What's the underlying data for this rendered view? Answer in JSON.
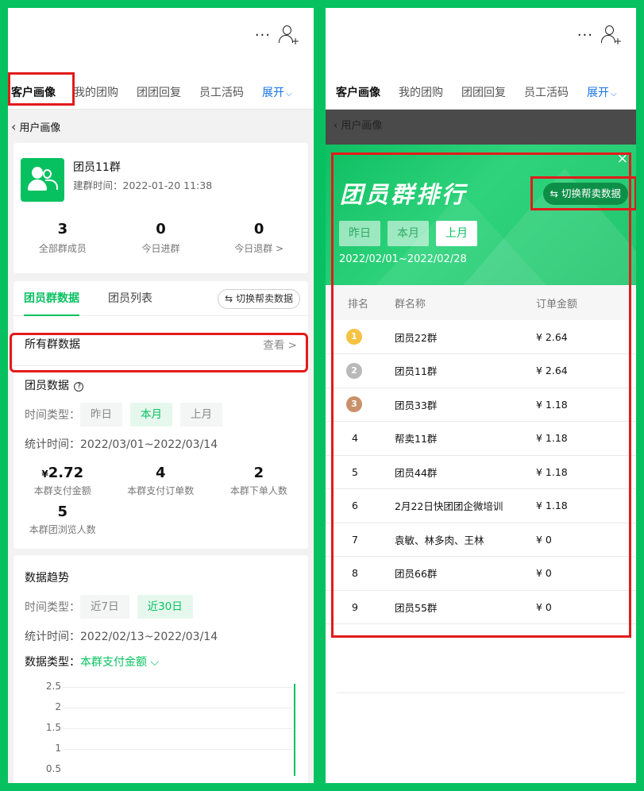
{
  "app": {
    "tabs": [
      "客户画像",
      "我的团购",
      "团团回复",
      "员工活码",
      "展开"
    ],
    "more_icon": "more-dots-icon",
    "user_icon": "add-user-icon",
    "back_label": "用户画像"
  },
  "left": {
    "group": {
      "name": "团员11群",
      "created": "建群时间：2022-01-20 11:38",
      "stats": [
        {
          "value": "3",
          "label": "全部群成员"
        },
        {
          "value": "0",
          "label": "今日进群"
        },
        {
          "value": "0",
          "label": "今日退群 >"
        }
      ]
    },
    "subtabs": [
      "团员群数据",
      "团员列表"
    ],
    "switch_label": "⇆ 切换帮卖数据",
    "all_groups": {
      "label": "所有群数据",
      "view": "查看 >"
    },
    "member_data": {
      "title": "团员数据",
      "time_type_label": "时间类型：",
      "chips": [
        "昨日",
        "本月",
        "上月"
      ],
      "stat_time": "统计时间：2022/03/01~2022/03/14",
      "kpis": [
        {
          "currency": "¥",
          "value": "2.72",
          "label": "本群支付金额"
        },
        {
          "value": "4",
          "label": "本群支付订单数"
        },
        {
          "value": "2",
          "label": "本群下单人数"
        },
        {
          "value": "5",
          "label": "本群团浏览人数"
        }
      ]
    },
    "trend": {
      "title": "数据趋势",
      "time_type_label": "时间类型：",
      "chips": [
        "近7日",
        "近30日"
      ],
      "stat_time": "统计时间：2022/02/13~2022/03/14",
      "data_type_label": "数据类型：",
      "data_type_value": "本群支付金额 ⌵",
      "y_ticks": [
        "2.5",
        "2",
        "1.5",
        "1",
        "0.5"
      ]
    }
  },
  "right": {
    "modal": {
      "title": "团员群排行",
      "close": "×",
      "switch_label": "⇆ 切换帮卖数据",
      "chips": [
        "昨日",
        "本月",
        "上月"
      ],
      "date_range": "2022/02/01~2022/02/28",
      "headers": [
        "排名",
        "群名称",
        "订单金额"
      ],
      "rows": [
        {
          "rank": "1",
          "name": "团员22群",
          "amount": "¥ 2.64"
        },
        {
          "rank": "2",
          "name": "团员11群",
          "amount": "¥ 2.64"
        },
        {
          "rank": "3",
          "name": "团员33群",
          "amount": "¥ 1.18"
        },
        {
          "rank": "4",
          "name": "帮卖11群",
          "amount": "¥ 1.18"
        },
        {
          "rank": "5",
          "name": "团员44群",
          "amount": "¥ 1.18"
        },
        {
          "rank": "6",
          "name": "2月22日快团团企微培训",
          "amount": "¥ 1.18"
        },
        {
          "rank": "7",
          "name": "袁敏、林多肉、王林",
          "amount": "¥ 0"
        },
        {
          "rank": "8",
          "name": "团员66群",
          "amount": "¥ 0"
        },
        {
          "rank": "9",
          "name": "团员55群",
          "amount": "¥ 0"
        }
      ]
    }
  },
  "colors": {
    "brand_green": "#07c160",
    "annotation_red": "#e21b1b",
    "link_blue": "#1a73e8"
  }
}
